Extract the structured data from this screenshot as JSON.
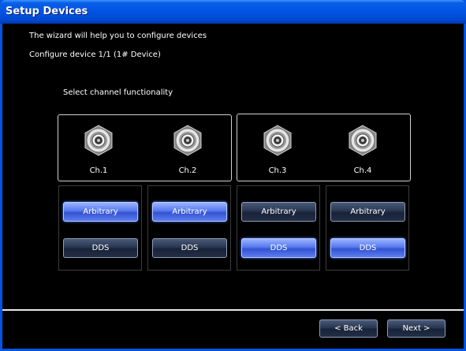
{
  "window": {
    "title": "Setup Devices"
  },
  "intro": {
    "line1": "The wizard will help you to configure devices",
    "line2": "Configure device 1/1 (1# Device)"
  },
  "section": {
    "label": "Select channel functionality"
  },
  "channels": [
    {
      "label": "Ch.1",
      "arbitrary_label": "Arbitrary",
      "dds_label": "DDS",
      "selected": "Arbitrary"
    },
    {
      "label": "Ch.2",
      "arbitrary_label": "Arbitrary",
      "dds_label": "DDS",
      "selected": "Arbitrary"
    },
    {
      "label": "Ch.3",
      "arbitrary_label": "Arbitrary",
      "dds_label": "DDS",
      "selected": "DDS"
    },
    {
      "label": "Ch.4",
      "arbitrary_label": "Arbitrary",
      "dds_label": "DDS",
      "selected": "DDS"
    }
  ],
  "footer": {
    "back_label": "< Back",
    "next_label": "Next >"
  },
  "colors": {
    "title_bar": "#0054e3",
    "background": "#000000",
    "selected_button": "#5578ee",
    "unselected_button": "#283650",
    "text": "#ffffff"
  }
}
